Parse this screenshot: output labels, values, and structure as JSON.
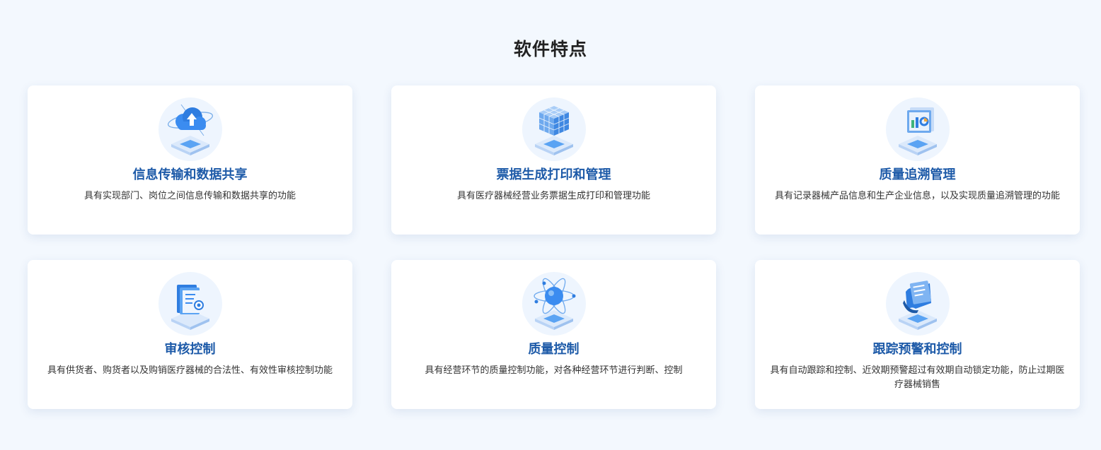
{
  "section": {
    "title": "软件特点"
  },
  "features": [
    {
      "icon": "cloud-upload-icon",
      "title": "信息传输和数据共享",
      "desc": "具有实现部门、岗位之间信息传输和数据共享的功能"
    },
    {
      "icon": "cube-grid-icon",
      "title": "票据生成打印和管理",
      "desc": "具有医疗器械经营业务票据生成打印和管理功能"
    },
    {
      "icon": "dashboard-screen-icon",
      "title": "质量追溯管理",
      "desc": "具有记录器械产品信息和生产企业信息，以及实现质量追溯管理的功能"
    },
    {
      "icon": "document-review-icon",
      "title": "审核控制",
      "desc": "具有供货者、购货者以及购销医疗器械的合法性、有效性审核控制功能"
    },
    {
      "icon": "atom-icon",
      "title": "质量控制",
      "desc": "具有经营环节的质量控制功能，对各种经营环节进行判断、控制"
    },
    {
      "icon": "alert-document-icon",
      "title": "跟踪预警和控制",
      "desc": "具有自动跟踪和控制、近效期预警超过有效期自动锁定功能，防止过期医疗器械销售"
    }
  ],
  "colors": {
    "background": "#f3f8fe",
    "accent": "#1d5aa8",
    "card": "#ffffff",
    "icon_blue": "#3b8cf0"
  }
}
